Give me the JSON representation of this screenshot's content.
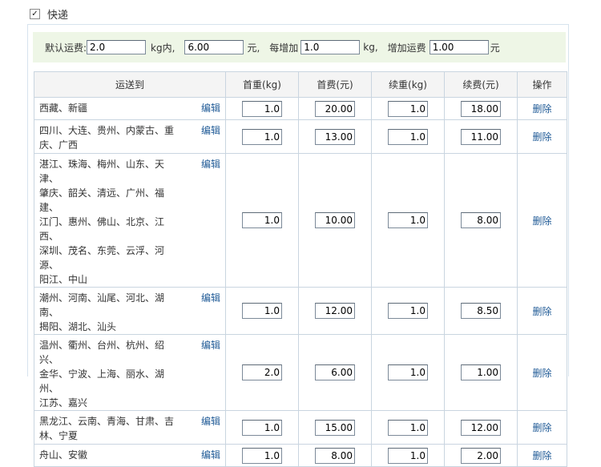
{
  "express": {
    "label": "快递",
    "checked": true,
    "check_mark": "✓"
  },
  "default_fee": {
    "label_default": "默认运费:",
    "first_weight": "2.0",
    "unit_kg_within": "kg内,",
    "first_fee": "6.00",
    "unit_yuan_1": "元,",
    "each_add_label": "每增加",
    "add_weight": "1.0",
    "unit_kg": "kg,",
    "add_fee_label": "增加运费",
    "add_fee": "1.00",
    "unit_yuan_2": "元"
  },
  "table": {
    "headers": [
      "运送到",
      "首重(kg)",
      "首费(元)",
      "续重(kg)",
      "续费(元)",
      "操作"
    ],
    "edit_label": "编辑",
    "delete_label": "删除",
    "rows": [
      {
        "regions": [
          "西藏、新疆"
        ],
        "first_weight": "1.0",
        "first_fee": "20.00",
        "add_weight": "1.0",
        "add_fee": "18.00"
      },
      {
        "regions": [
          "四川、大连、贵州、内蒙古、重",
          "庆、广西"
        ],
        "first_weight": "1.0",
        "first_fee": "13.00",
        "add_weight": "1.0",
        "add_fee": "11.00"
      },
      {
        "regions": [
          "湛江、珠海、梅州、山东、天津、",
          "肇庆、韶关、清远、广州、福建、",
          "江门、惠州、佛山、北京、江西、",
          "深圳、茂名、东莞、云浮、河源、",
          "阳江、中山"
        ],
        "first_weight": "1.0",
        "first_fee": "10.00",
        "add_weight": "1.0",
        "add_fee": "8.00"
      },
      {
        "regions": [
          "潮州、河南、汕尾、河北、湖南、",
          "揭阳、湖北、汕头"
        ],
        "first_weight": "1.0",
        "first_fee": "12.00",
        "add_weight": "1.0",
        "add_fee": "8.50"
      },
      {
        "regions": [
          "温州、衢州、台州、杭州、绍兴、",
          "金华、宁波、上海、丽水、湖州、",
          "江苏、嘉兴"
        ],
        "first_weight": "2.0",
        "first_fee": "6.00",
        "add_weight": "1.0",
        "add_fee": "1.00"
      },
      {
        "regions": [
          "黑龙江、云南、青海、甘肃、吉",
          "林、宁夏"
        ],
        "first_weight": "1.0",
        "first_fee": "15.00",
        "add_weight": "1.0",
        "add_fee": "12.00"
      },
      {
        "regions": [
          "舟山、安徽"
        ],
        "first_weight": "1.0",
        "first_fee": "8.00",
        "add_weight": "1.0",
        "add_fee": "2.00"
      }
    ]
  }
}
